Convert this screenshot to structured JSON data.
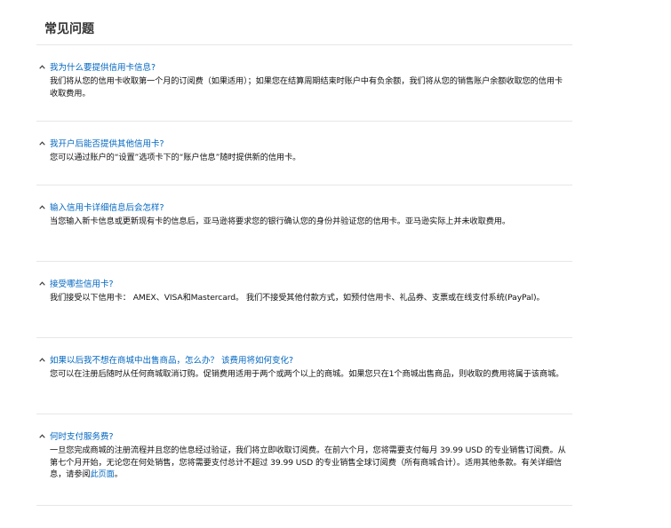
{
  "faq": {
    "title": "常见问题",
    "items": [
      {
        "question": "我为什么要提供信用卡信息?",
        "answer": "我们将从您的信用卡收取第一个月的订阅费（如果适用）；如果您在结算周期结束时账户中有负余额，我们将从您的销售账户余额收取您的信用卡收取费用。"
      },
      {
        "question": "我开户后能否提供其他信用卡?",
        "answer": "您可以通过账户的“设置”选项卡下的“账户信息”随时提供新的信用卡。"
      },
      {
        "question": "输入信用卡详细信息后会怎样?",
        "answer": "当您输入新卡信息或更新现有卡的信息后，亚马逊将要求您的银行确认您的身份并验证您的信用卡。亚马逊实际上并未收取费用。"
      },
      {
        "question": "接受哪些信用卡?",
        "answer": "我们接受以下信用卡： AMEX、VISA和Mastercard。 我们不接受其他付款方式，如预付信用卡、礼品券、支票或在线支付系统(PayPal)。"
      },
      {
        "question": "如果以后我不想在商城中出售商品，怎么办？ 该费用将如何变化?",
        "answer": "您可以在注册后随时从任何商城取消订购。促销费用适用于两个或两个以上的商城。如果您只在1个商城出售商品，则收取的费用将属于该商城。"
      },
      {
        "question": "何时支付服务费?",
        "answer": "一旦您完成商城的注册流程并且您的信息经过验证，我们将立即收取订阅费。在前六个月，您将需要支付每月 39.99 USD 的专业销售订阅费。从第七个月开始，无论您在何处销售，您将需要支付总计不超过 39.99 USD 的专业销售全球订阅费（所有商城合计）。适用其他条款。有关详细信息，请参阅",
        "link": "此页面",
        "answer_end": "。"
      }
    ]
  },
  "colors": {
    "link": "#0066c0",
    "divider": "#e7e7e7",
    "text": "#111111"
  },
  "icons": {
    "expanded": "chevron-up-icon"
  }
}
